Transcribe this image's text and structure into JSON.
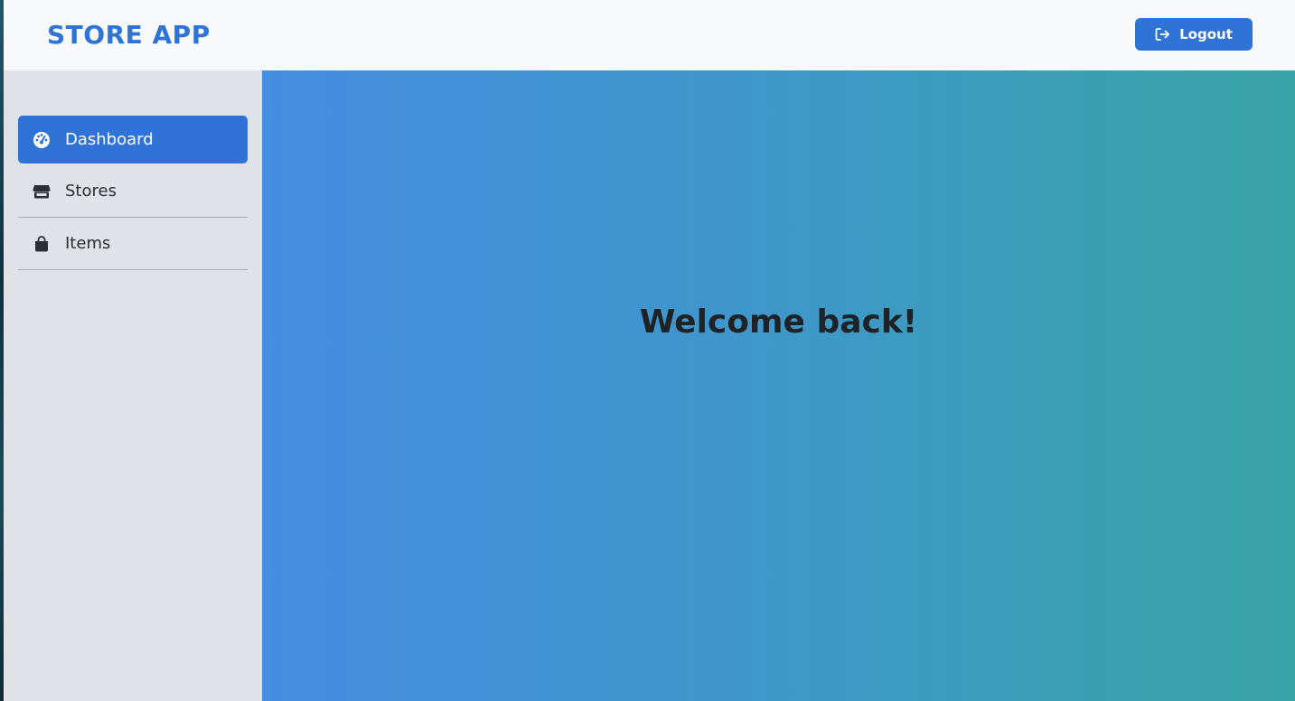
{
  "app": {
    "title": "STORE APP",
    "accent_color": "#2f73d6"
  },
  "header": {
    "logout": {
      "label": "Logout",
      "icon": "logout-icon"
    }
  },
  "sidebar": {
    "items": [
      {
        "label": "Dashboard",
        "icon": "dashboard-gauge-icon",
        "active": true
      },
      {
        "label": "Stores",
        "icon": "store-icon",
        "active": false
      },
      {
        "label": "Items",
        "icon": "shopping-bag-icon",
        "active": false
      }
    ]
  },
  "main": {
    "heading": "Welcome back!"
  }
}
